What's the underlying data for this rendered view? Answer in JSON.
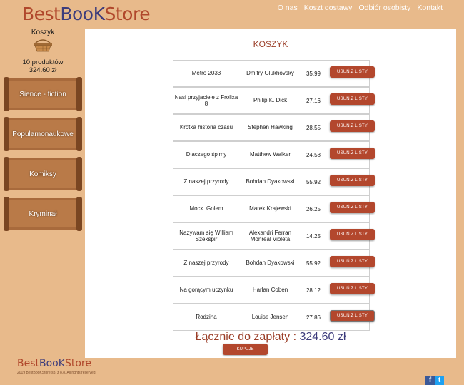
{
  "brand": {
    "part1": "Best",
    "part2": "BooK",
    "part3": "Store"
  },
  "nav": [
    "O nas",
    "Koszt dostawy",
    "Odbiór osobisty",
    "Kontakt"
  ],
  "cart": {
    "title": "Koszyk",
    "count": "10 produktów",
    "sum": "324.60 zł"
  },
  "categories": [
    "Sience - fiction",
    "Popularnonaukowe",
    "Komiksy",
    "Kryminał"
  ],
  "main_title": "KOSZYK",
  "remove_label": "USUŃ Z LISTY",
  "items": [
    {
      "title": "Metro 2033",
      "author": "Dmitry Glukhovsky",
      "price": "35.99"
    },
    {
      "title": "Nasi przyjaciele z Frolixa 8",
      "author": "Philip K. Dick",
      "price": "27.16"
    },
    {
      "title": "Krótka historia czasu",
      "author": "Stephen Hawking",
      "price": "28.55"
    },
    {
      "title": "Dlaczego śpimy",
      "author": "Matthew Walker",
      "price": "24.58"
    },
    {
      "title": "Z naszej przyrody",
      "author": "Bohdan Dyakowski",
      "price": "55.92"
    },
    {
      "title": "Mock. Golem",
      "author": "Marek Krajewski",
      "price": "26.25"
    },
    {
      "title": "Nazywam się William Szekspir",
      "author": "Alexandri Ferran Monreal Violeta",
      "price": "14.25"
    },
    {
      "title": "Z naszej przyrody",
      "author": "Bohdan Dyakowski",
      "price": "55.92"
    },
    {
      "title": "Na gorącym uczynku",
      "author": "Harlan Coben",
      "price": "28.12"
    },
    {
      "title": "Rodzina",
      "author": "Louise Jensen",
      "price": "27.86"
    }
  ],
  "total_label": "Łącznie do zapłaty :",
  "total_value": "324.60 zł",
  "buy_label": "KUPUJĘ",
  "footer": {
    "copyright": "2019 BestBooKStore sp. z o.o. All rights reserved"
  },
  "social": {
    "facebook": "f",
    "twitter": "t"
  }
}
